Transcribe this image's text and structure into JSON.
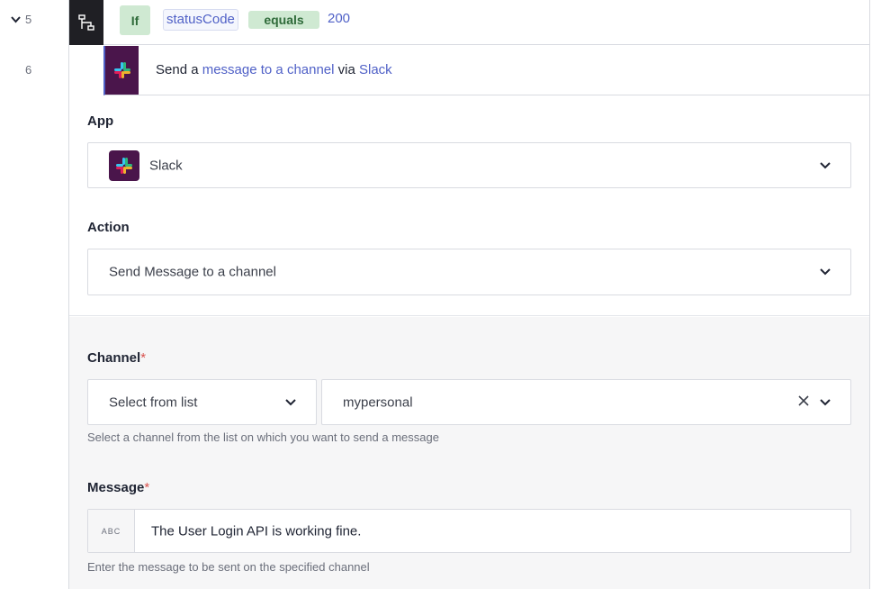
{
  "gutter": {
    "row5_number": "5",
    "row6_number": "6"
  },
  "row5": {
    "keyword": "If",
    "variable": "statusCode",
    "operator": "equals",
    "value": "200",
    "icon": "branch-icon"
  },
  "row6": {
    "prefix": "Send a ",
    "action_link": "message to a channel",
    "middle": " via ",
    "app_link": "Slack",
    "icon": "slack-icon"
  },
  "app_field": {
    "label": "App",
    "value": "Slack"
  },
  "action_field": {
    "label": "Action",
    "value": "Send Message to a channel"
  },
  "channel_field": {
    "label": "Channel",
    "required_mark": "*",
    "mode_value": "Select from list",
    "value": "mypersonal",
    "help": "Select a channel from the list on which you want to send a message"
  },
  "message_field": {
    "label": "Message",
    "required_mark": "*",
    "type_badge": "ABC",
    "value": "The User Login API is working fine.",
    "help": "Enter the message to be sent on the specified channel"
  },
  "colors": {
    "accent": "#5061c7",
    "green_chip": "#cfe9d2",
    "slack_purple": "#4a154b",
    "required": "#d9534f"
  }
}
